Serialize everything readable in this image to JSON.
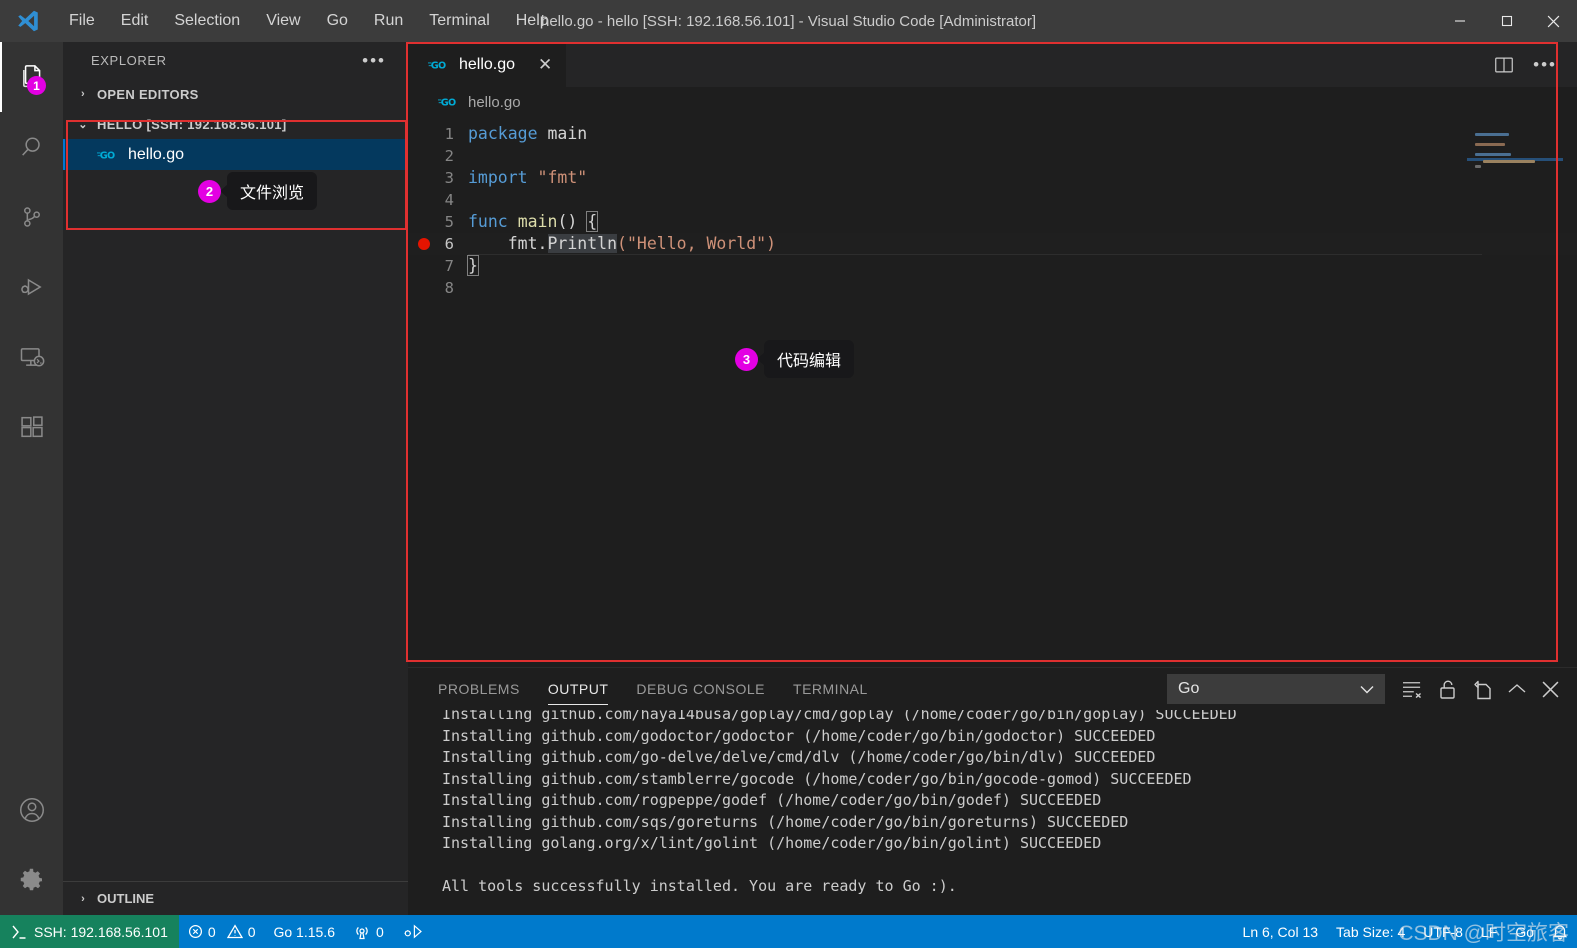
{
  "window": {
    "title": "hello.go - hello [SSH: 192.168.56.101] - Visual Studio Code [Administrator]",
    "controls": {
      "minimize": "—",
      "maximize": "□",
      "close": "✕"
    }
  },
  "menubar": {
    "items": [
      {
        "label": "File"
      },
      {
        "label": "Edit"
      },
      {
        "label": "Selection"
      },
      {
        "label": "View"
      },
      {
        "label": "Go"
      },
      {
        "label": "Run"
      },
      {
        "label": "Terminal"
      },
      {
        "label": "Help"
      }
    ]
  },
  "activitybar": {
    "items": [
      {
        "name": "explorer",
        "icon": "files-icon",
        "badge": "1",
        "active": true
      },
      {
        "name": "search",
        "icon": "search-icon",
        "badge": "",
        "active": false
      },
      {
        "name": "source-control",
        "icon": "source-control-icon",
        "badge": "",
        "active": false
      },
      {
        "name": "run-and-debug",
        "icon": "run-debug-icon",
        "badge": "",
        "active": false
      },
      {
        "name": "remote-explorer",
        "icon": "remote-explorer-icon",
        "badge": "",
        "active": false
      },
      {
        "name": "extensions",
        "icon": "extensions-icon",
        "badge": "",
        "active": false
      }
    ],
    "bottom": [
      {
        "name": "accounts",
        "icon": "account-icon"
      },
      {
        "name": "manage",
        "icon": "gear-icon"
      }
    ]
  },
  "sidebar": {
    "title": "EXPLORER",
    "more_actions": "•••",
    "sections": {
      "open_editors": {
        "label": "OPEN EDITORS",
        "expanded": false,
        "chevron": "›"
      },
      "workspace": {
        "label": "HELLO [SSH: 192.168.56.101]",
        "expanded": true,
        "chevron": "⌄"
      },
      "outline": {
        "label": "OUTLINE",
        "expanded": false,
        "chevron": "›"
      }
    },
    "files": [
      {
        "name": "hello.go",
        "icon": "go-file-icon",
        "selected": true
      }
    ]
  },
  "callouts": [
    {
      "num": "2",
      "text": "文件浏览"
    },
    {
      "num": "3",
      "text": "代码编辑"
    }
  ],
  "editor": {
    "tab": {
      "label": "hello.go",
      "icon": "go-file-icon",
      "close": "✕",
      "dirty": false
    },
    "actions": [
      {
        "name": "split-editor",
        "icon": "split-editor-icon"
      },
      {
        "name": "more-actions",
        "icon": "ellipsis-icon",
        "glyph": "•••"
      }
    ],
    "breadcrumb": [
      {
        "label": "hello.go",
        "icon": "go-file-icon"
      }
    ],
    "language": "go",
    "lines": [
      {
        "n": "1",
        "breakpoint": false,
        "tokens": [
          {
            "t": "package",
            "c": "kw"
          },
          {
            "t": " "
          },
          {
            "t": "main",
            "c": "pl"
          }
        ]
      },
      {
        "n": "2",
        "breakpoint": false,
        "tokens": []
      },
      {
        "n": "3",
        "breakpoint": false,
        "tokens": [
          {
            "t": "import",
            "c": "kw"
          },
          {
            "t": " "
          },
          {
            "t": "\"fmt\"",
            "c": "str"
          }
        ]
      },
      {
        "n": "4",
        "breakpoint": false,
        "tokens": []
      },
      {
        "n": "5",
        "breakpoint": false,
        "tokens": [
          {
            "t": "func",
            "c": "kw"
          },
          {
            "t": " "
          },
          {
            "t": "main",
            "c": "fn"
          },
          {
            "t": "()",
            "c": "pl"
          },
          {
            "t": " "
          },
          {
            "t": "{",
            "c": "brkt"
          }
        ]
      },
      {
        "n": "6",
        "breakpoint": true,
        "current": true,
        "tokens": [
          {
            "t": "    "
          },
          {
            "t": "fmt",
            "c": "pl"
          },
          {
            "t": ".",
            "c": "pl"
          },
          {
            "t": "Println",
            "c": "hl-word"
          },
          {
            "t": "(",
            "c": "str"
          },
          {
            "t": "\"Hello, World\"",
            "c": "str"
          },
          {
            "t": ")",
            "c": "str"
          }
        ]
      },
      {
        "n": "7",
        "breakpoint": false,
        "tokens": [
          {
            "t": "}",
            "c": "brkt"
          }
        ]
      },
      {
        "n": "8",
        "breakpoint": false,
        "tokens": []
      }
    ]
  },
  "panel": {
    "tabs": [
      {
        "label": "PROBLEMS",
        "active": false
      },
      {
        "label": "OUTPUT",
        "active": true
      },
      {
        "label": "DEBUG CONSOLE",
        "active": false
      },
      {
        "label": "TERMINAL",
        "active": false
      }
    ],
    "output_channel": {
      "value": "Go",
      "chevron": "⌄"
    },
    "actions": [
      {
        "name": "clear-output-button",
        "icon": "clear-output-icon"
      },
      {
        "name": "lock-scroll-button",
        "icon": "unlock-icon"
      },
      {
        "name": "open-in-editor-button",
        "icon": "open-in-editor-icon"
      },
      {
        "name": "maximize-panel-button",
        "icon": "chevron-up-icon",
        "glyph": "⌃"
      },
      {
        "name": "close-panel-button",
        "icon": "close-icon",
        "glyph": "✕"
      }
    ],
    "output_lines": [
      "Installing github.com/haya14busa/goplay/cmd/goplay (/home/coder/go/bin/goplay) SUCCEEDED",
      "Installing github.com/godoctor/godoctor (/home/coder/go/bin/godoctor) SUCCEEDED",
      "Installing github.com/go-delve/delve/cmd/dlv (/home/coder/go/bin/dlv) SUCCEEDED",
      "Installing github.com/stamblerre/gocode (/home/coder/go/bin/gocode-gomod) SUCCEEDED",
      "Installing github.com/rogpeppe/godef (/home/coder/go/bin/godef) SUCCEEDED",
      "Installing github.com/sqs/goreturns (/home/coder/go/bin/goreturns) SUCCEEDED",
      "Installing golang.org/x/lint/golint (/home/coder/go/bin/golint) SUCCEEDED",
      "",
      "All tools successfully installed. You are ready to Go :)."
    ]
  },
  "statusbar": {
    "remote": {
      "label": "SSH: 192.168.56.101",
      "icon": "remote-icon"
    },
    "left": [
      {
        "name": "problems",
        "errors": "0",
        "warnings": "0",
        "error_icon": "error-icon",
        "warning_icon": "warning-icon"
      },
      {
        "name": "go-version",
        "label": "Go 1.15.6"
      },
      {
        "name": "radar",
        "label": "0",
        "icon": "broadcast-icon"
      },
      {
        "name": "go-tools",
        "label": "",
        "icon": "go-tools-icon"
      }
    ],
    "right": [
      {
        "name": "cursor-position",
        "label": "Ln 6, Col 13"
      },
      {
        "name": "tab-size",
        "label": "Tab Size: 4"
      },
      {
        "name": "encoding",
        "label": "UTF-8"
      },
      {
        "name": "eol",
        "label": "LF"
      },
      {
        "name": "language-mode",
        "label": "Go"
      },
      {
        "name": "notifications",
        "icon": "bell-icon"
      }
    ]
  },
  "watermark": {
    "text": "CSDN @时空旅客"
  },
  "colors": {
    "titlebar": "#3c3c3c",
    "activitybar": "#333333",
    "sidebar": "#252526",
    "editor": "#1e1e1e",
    "statusbar_blue": "#007acc",
    "remote_green": "#16825d",
    "selection_blue": "#04395e",
    "annotation_pink": "#e300e3",
    "annotation_red": "#e03030",
    "keyword": "#569cd6",
    "string": "#ce9178",
    "function": "#dcdcaa",
    "breakpoint_red": "#e51400",
    "go_icon": "#00acd7"
  }
}
